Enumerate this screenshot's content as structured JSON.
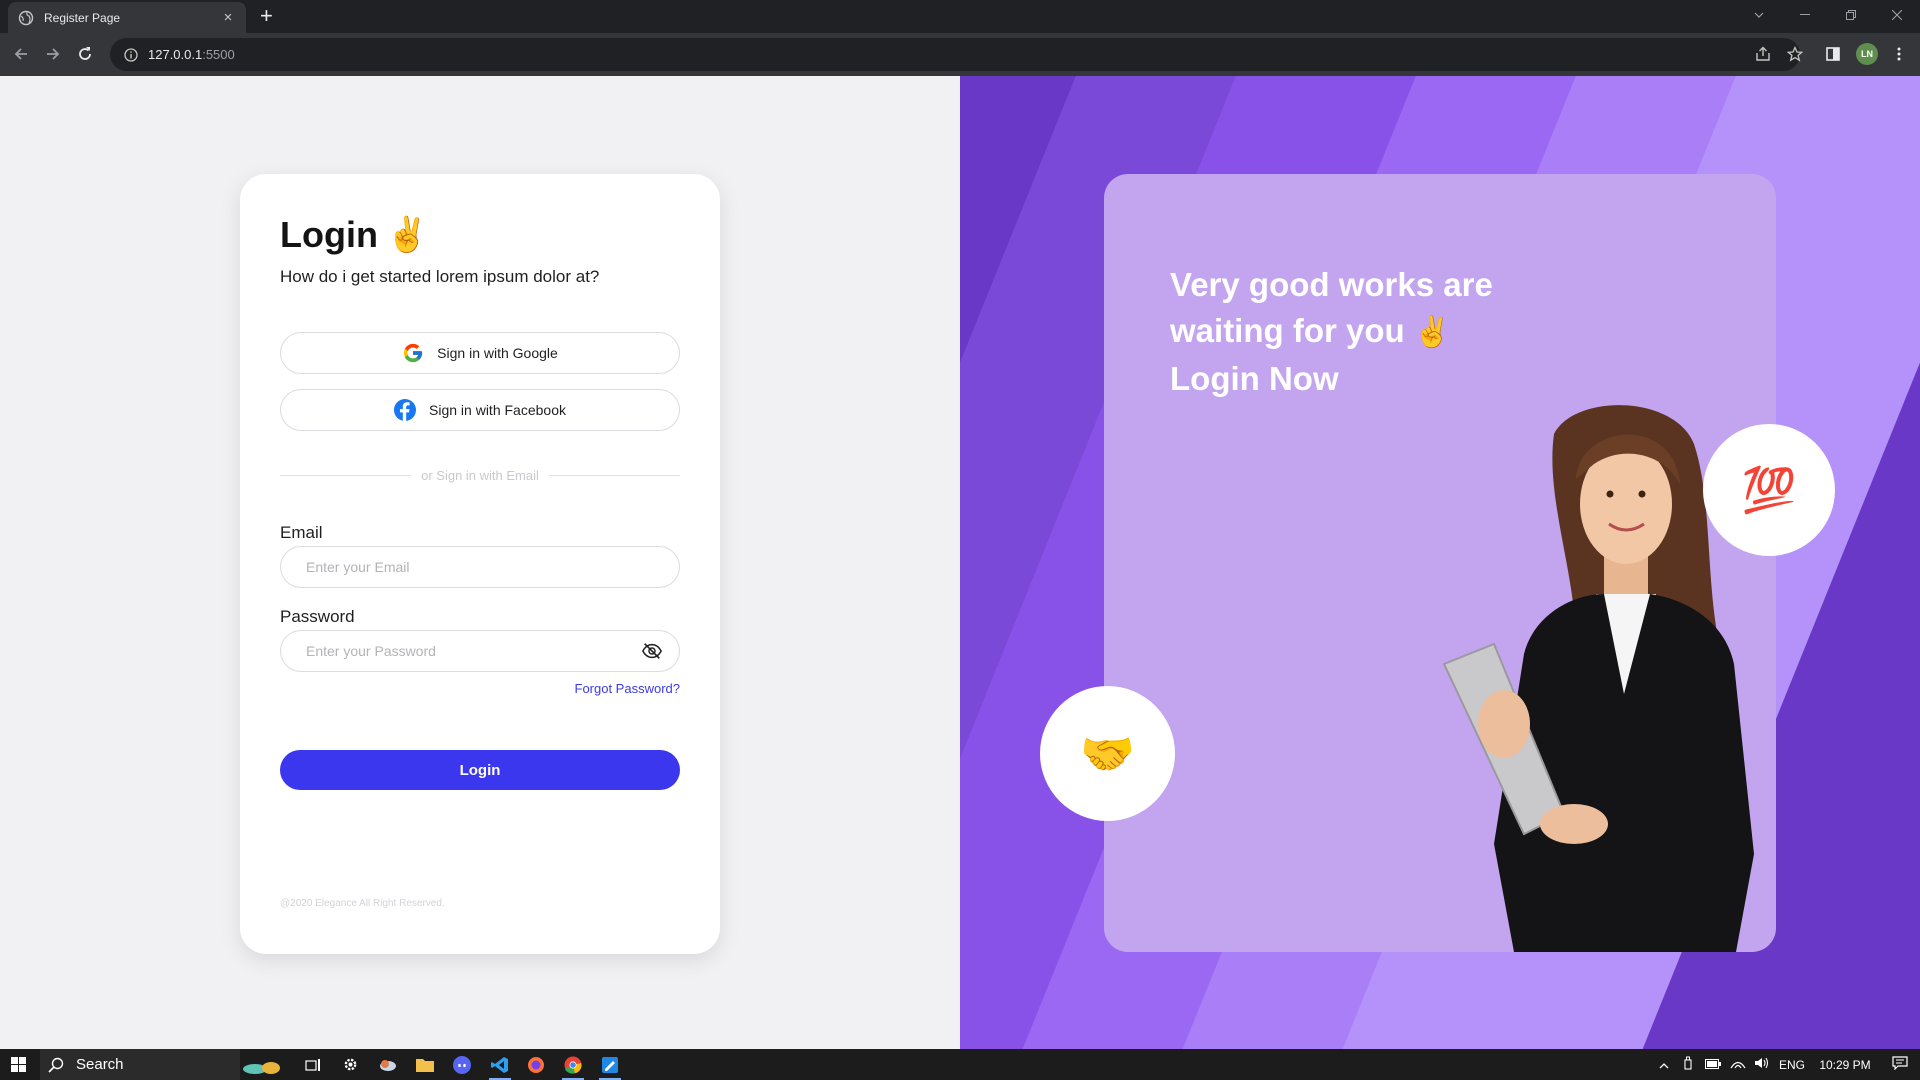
{
  "browser": {
    "tab_title": "Register Page",
    "tab_close": "×",
    "new_tab": "+",
    "url_host": "127.0.0.1",
    "url_port": ":5500",
    "profile_initials": "LN"
  },
  "login": {
    "title": "Login",
    "title_emoji": "✌",
    "subtitle": "How do i get started lorem ipsum dolor at?",
    "google_label": "Sign in with Google",
    "facebook_label": "Sign in with Facebook",
    "divider_text": "or Sign in with Email",
    "email_label": "Email",
    "email_placeholder": "Enter your Email",
    "email_value": "",
    "password_label": "Password",
    "password_placeholder": "Enter your Password",
    "password_value": "",
    "forgot_label": "Forgot Password?",
    "submit_label": "Login",
    "copyright": "@2020 Elegance All Right Reserved."
  },
  "promo": {
    "line1": "Very good works are",
    "line2": "waiting for you",
    "line2_emoji": "✌",
    "line3": "Login Now",
    "badge_top_emoji": "💯",
    "badge_bottom_emoji": "🤝"
  },
  "taskbar": {
    "search_label": "Search",
    "language": "ENG",
    "time": "10:29 PM"
  },
  "colors": {
    "accent": "#3b37ee",
    "purple_dark": "#6a38c6",
    "promo_card": "#c3a5ef"
  }
}
